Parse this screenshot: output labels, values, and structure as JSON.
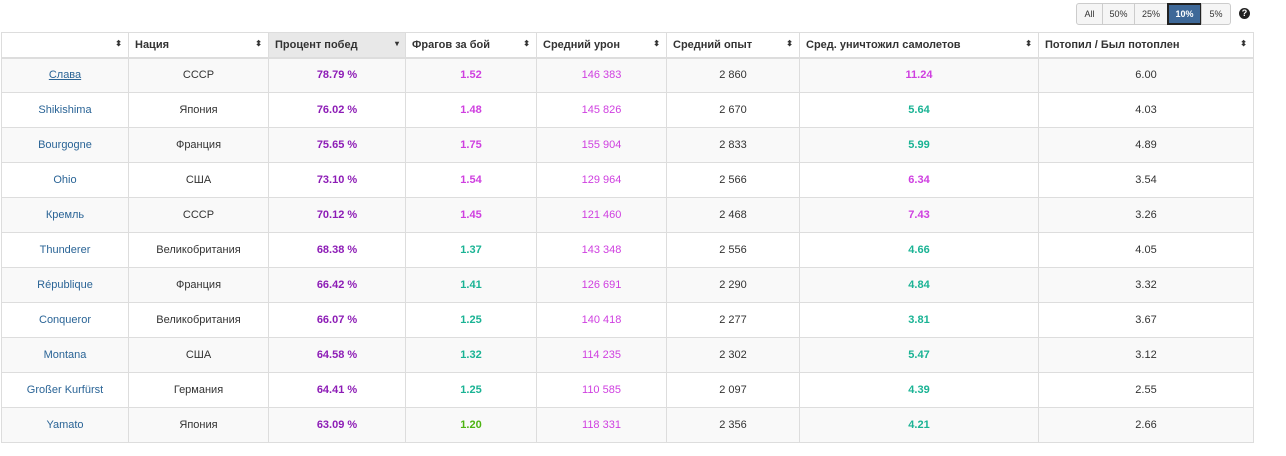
{
  "filters": {
    "all": "All",
    "p50": "50%",
    "p25": "25%",
    "p10": "10%",
    "p5": "5%",
    "active": "10%"
  },
  "help_icon": "?",
  "sort_icon": "⬍",
  "sort_desc_icon": "▾",
  "columns": [
    "",
    "Нация",
    "Процент побед",
    "Фрагов за бой",
    "Средний урон",
    "Средний опыт",
    "Сред. уничтожил самолетов",
    "Потопил / Был потоплен"
  ],
  "sorted_column": "Процент побед",
  "colors": {
    "purple_strong": "#8d1cb6",
    "purple": "#cf3fe0",
    "teal": "#1ab394",
    "green": "#4db412",
    "link": "#2a6496",
    "active_filter": "#3e6898"
  },
  "rows": [
    {
      "ship": "Слава",
      "nation": "СССР",
      "winrate": "78.79 %",
      "frags": "1.52",
      "frags_color": "purple",
      "damage": "146 383",
      "exp": "2 860",
      "planes": "11.24",
      "planes_color": "purple",
      "kd": "6.00"
    },
    {
      "ship": "Shikishima",
      "nation": "Япония",
      "winrate": "76.02 %",
      "frags": "1.48",
      "frags_color": "purple",
      "damage": "145 826",
      "exp": "2 670",
      "planes": "5.64",
      "planes_color": "teal",
      "kd": "4.03"
    },
    {
      "ship": "Bourgogne",
      "nation": "Франция",
      "winrate": "75.65 %",
      "frags": "1.75",
      "frags_color": "purple",
      "damage": "155 904",
      "exp": "2 833",
      "planes": "5.99",
      "planes_color": "teal",
      "kd": "4.89"
    },
    {
      "ship": "Ohio",
      "nation": "США",
      "winrate": "73.10 %",
      "frags": "1.54",
      "frags_color": "purple",
      "damage": "129 964",
      "exp": "2 566",
      "planes": "6.34",
      "planes_color": "purple",
      "kd": "3.54"
    },
    {
      "ship": "Кремль",
      "nation": "СССР",
      "winrate": "70.12 %",
      "frags": "1.45",
      "frags_color": "purple",
      "damage": "121 460",
      "exp": "2 468",
      "planes": "7.43",
      "planes_color": "purple",
      "kd": "3.26"
    },
    {
      "ship": "Thunderer",
      "nation": "Великобритания",
      "winrate": "68.38 %",
      "frags": "1.37",
      "frags_color": "teal",
      "damage": "143 348",
      "exp": "2 556",
      "planes": "4.66",
      "planes_color": "teal",
      "kd": "4.05"
    },
    {
      "ship": "République",
      "nation": "Франция",
      "winrate": "66.42 %",
      "frags": "1.41",
      "frags_color": "teal",
      "damage": "126 691",
      "exp": "2 290",
      "planes": "4.84",
      "planes_color": "teal",
      "kd": "3.32"
    },
    {
      "ship": "Conqueror",
      "nation": "Великобритания",
      "winrate": "66.07 %",
      "frags": "1.25",
      "frags_color": "teal",
      "damage": "140 418",
      "exp": "2 277",
      "planes": "3.81",
      "planes_color": "teal",
      "kd": "3.67"
    },
    {
      "ship": "Montana",
      "nation": "США",
      "winrate": "64.58 %",
      "frags": "1.32",
      "frags_color": "teal",
      "damage": "114 235",
      "exp": "2 302",
      "planes": "5.47",
      "planes_color": "teal",
      "kd": "3.12"
    },
    {
      "ship": "Großer Kurfürst",
      "nation": "Германия",
      "winrate": "64.41 %",
      "frags": "1.25",
      "frags_color": "teal",
      "damage": "110 585",
      "exp": "2 097",
      "planes": "4.39",
      "planes_color": "teal",
      "kd": "2.55"
    },
    {
      "ship": "Yamato",
      "nation": "Япония",
      "winrate": "63.09 %",
      "frags": "1.20",
      "frags_color": "green",
      "damage": "118 331",
      "exp": "2 356",
      "planes": "4.21",
      "planes_color": "teal",
      "kd": "2.66"
    }
  ]
}
